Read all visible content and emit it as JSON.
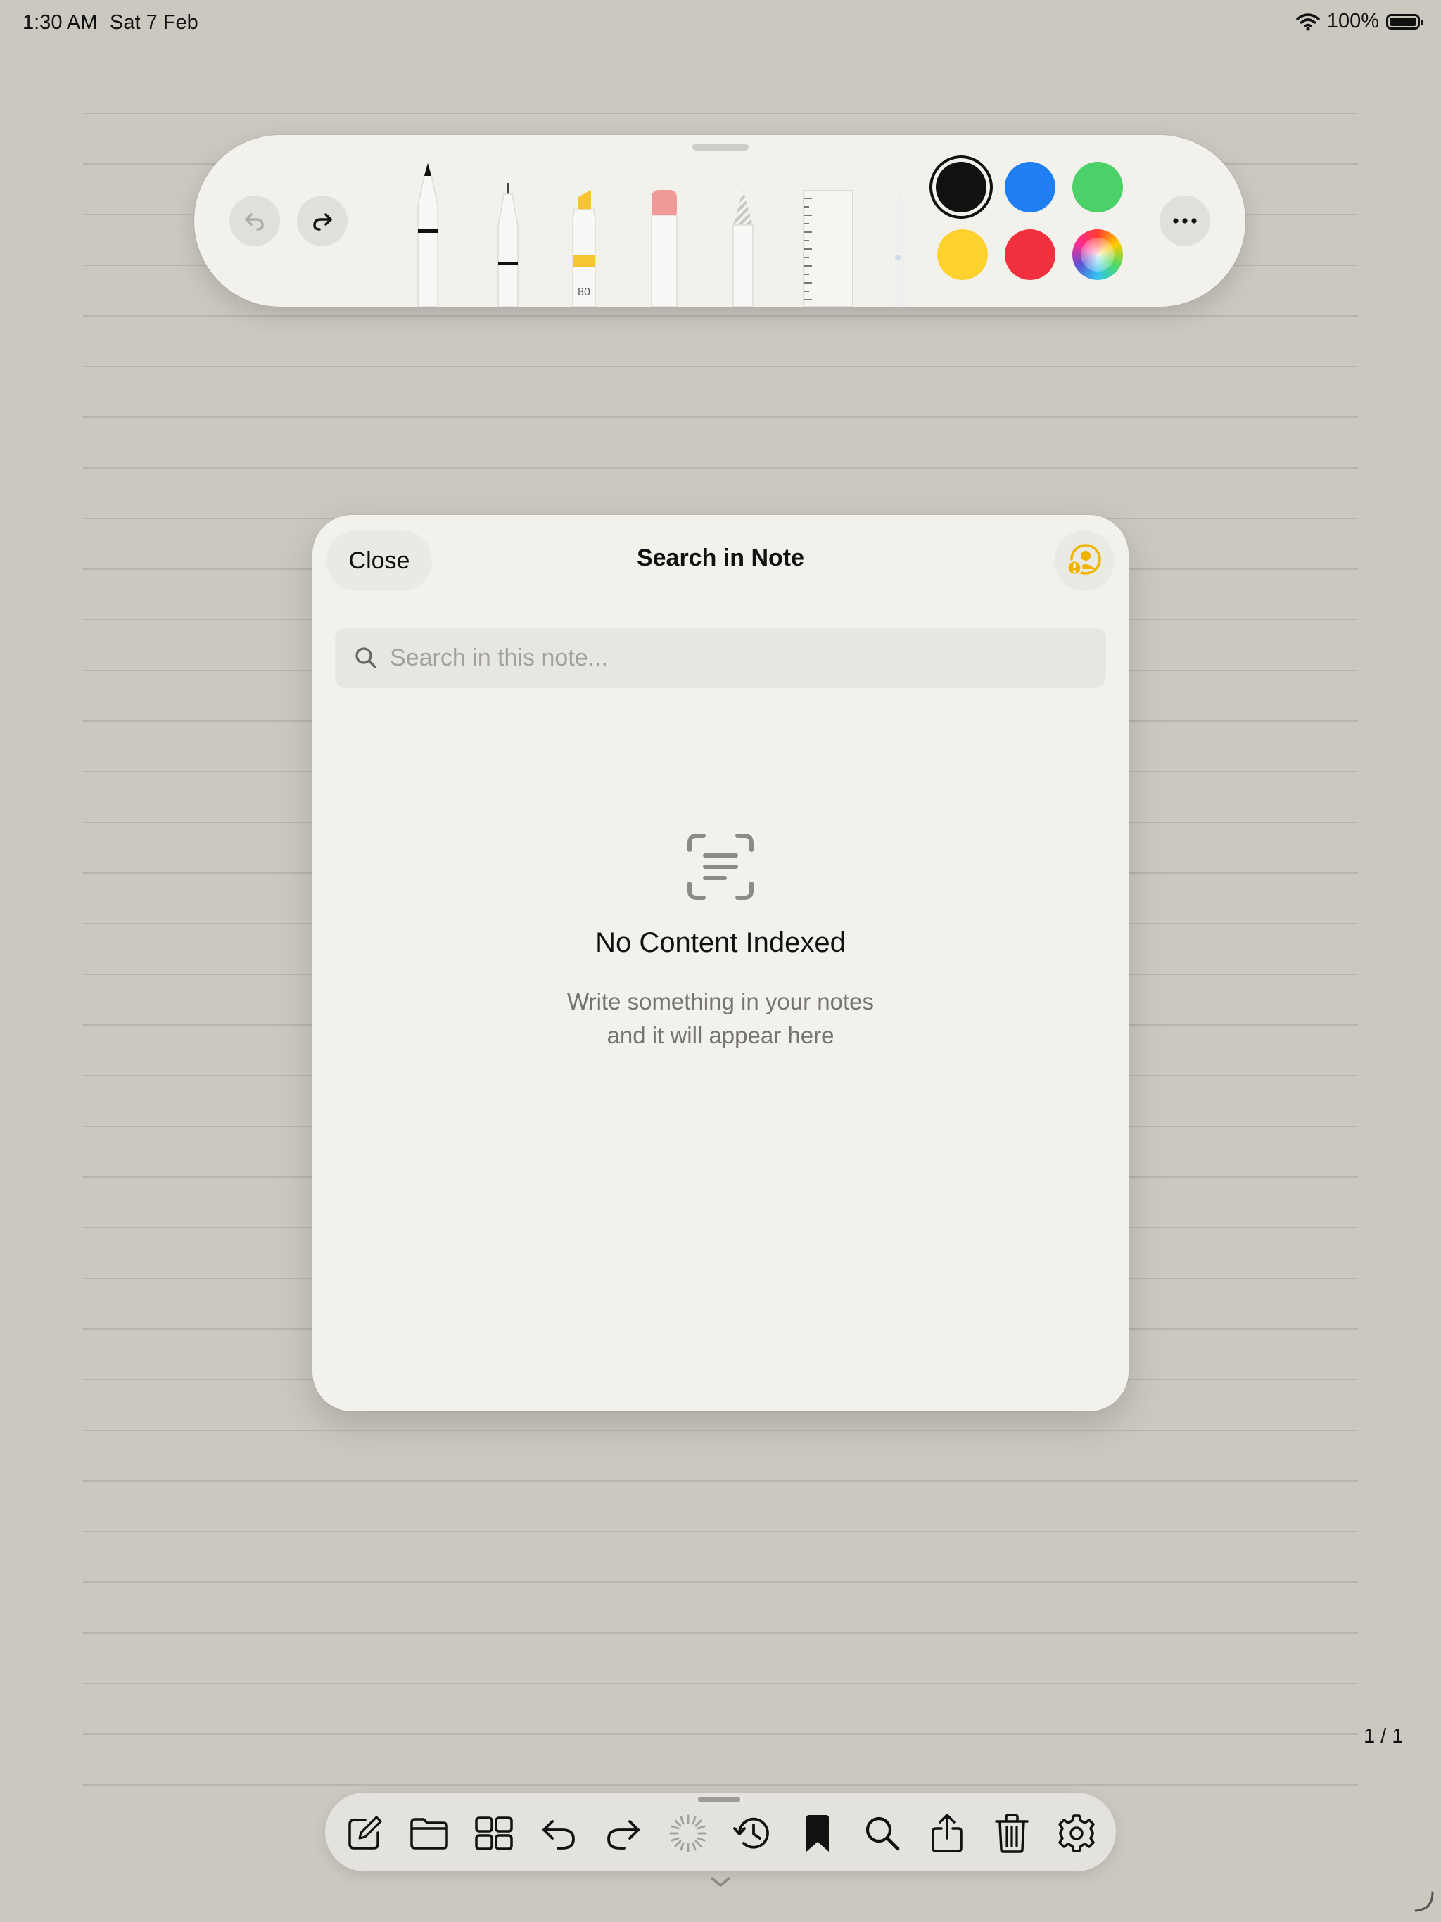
{
  "status_bar": {
    "time": "1:30 AM",
    "date": "Sat 7 Feb",
    "battery": "100%",
    "wifi_icon": "wifi-icon",
    "battery_icon": "battery-icon"
  },
  "palette": {
    "undo_icon": "undo-icon",
    "redo_icon": "redo-icon",
    "tools": [
      "pen",
      "fineliner",
      "highlighter",
      "eraser",
      "pencil",
      "ruler",
      "lasso"
    ],
    "highlighter_label": "80",
    "colors": [
      "#111111",
      "#1f7ff0",
      "#4cd068",
      "#fdd22e",
      "#f0303f",
      "color-wheel"
    ],
    "selected_color": "#111111",
    "more_icon": "ellipsis-icon"
  },
  "modal": {
    "close_label": "Close",
    "title": "Search in Note",
    "account_icon": "person-warning-icon",
    "search_placeholder": "Search in this note...",
    "empty_title": "No Content Indexed",
    "empty_line1": "Write something in your notes",
    "empty_line2": "and it will appear here"
  },
  "pager": "1 / 1",
  "dock": {
    "buttons": [
      "compose-icon",
      "folder-icon",
      "grid-icon",
      "undo-icon",
      "redo-icon",
      "loading-icon",
      "history-icon",
      "bookmark-icon",
      "search-icon",
      "share-icon",
      "trash-icon",
      "settings-icon"
    ]
  },
  "accent_color": "#f0b400"
}
